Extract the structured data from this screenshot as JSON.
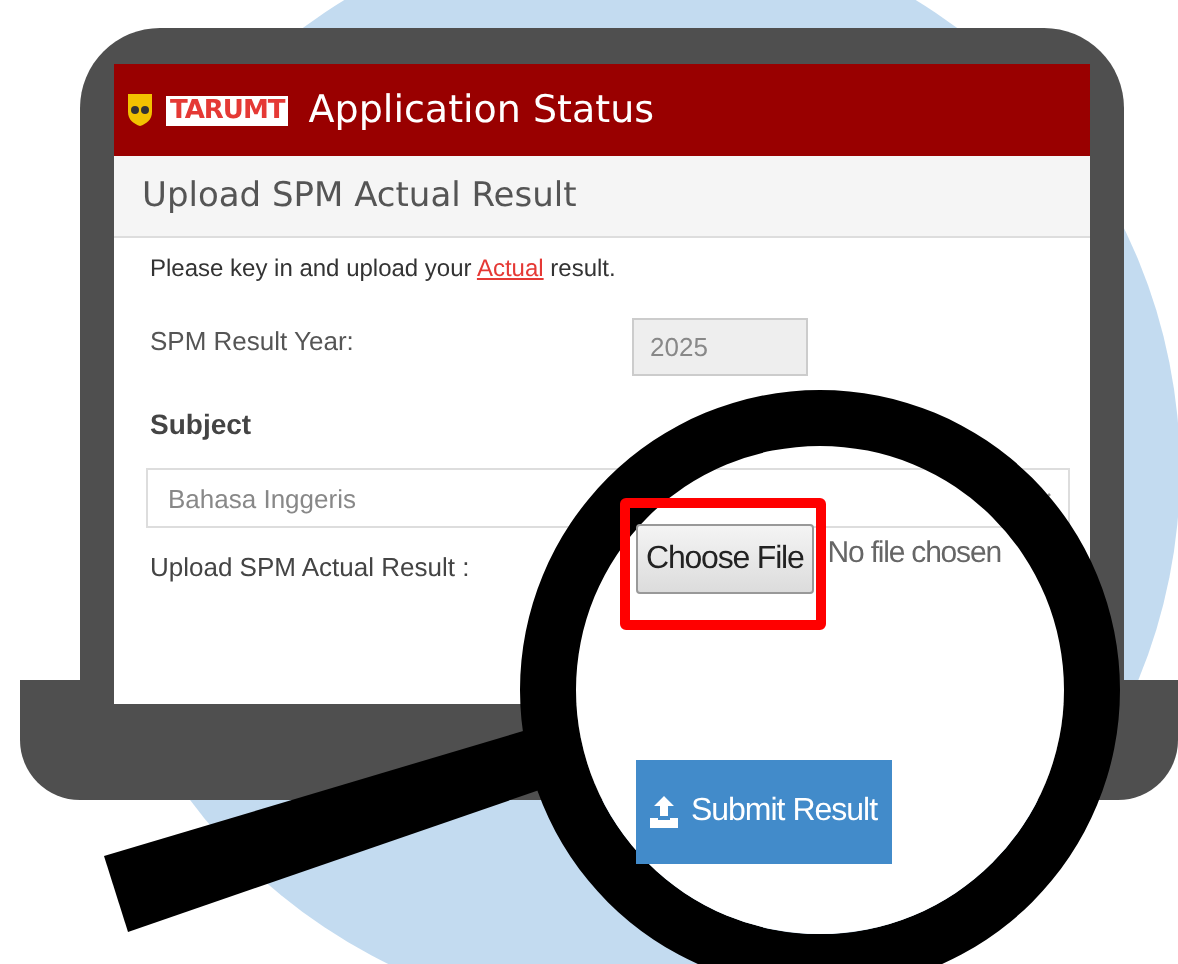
{
  "header": {
    "logo_text": "TARUMT",
    "title": "Application Status"
  },
  "panel": {
    "heading": "Upload SPM Actual Result",
    "instruction": {
      "before": "Please key in and upload your",
      "link": "Actual",
      "after": "result."
    },
    "year": {
      "label": "SPM Result Year:",
      "value": "2025",
      "disabled": true
    },
    "subject": {
      "label": "Subject",
      "value": "Bahasa Inggeris"
    },
    "upload": {
      "label": "Upload SPM Actual Result :",
      "button": "Choose File",
      "status": "No file chosen"
    },
    "submit": "Submit Result"
  }
}
